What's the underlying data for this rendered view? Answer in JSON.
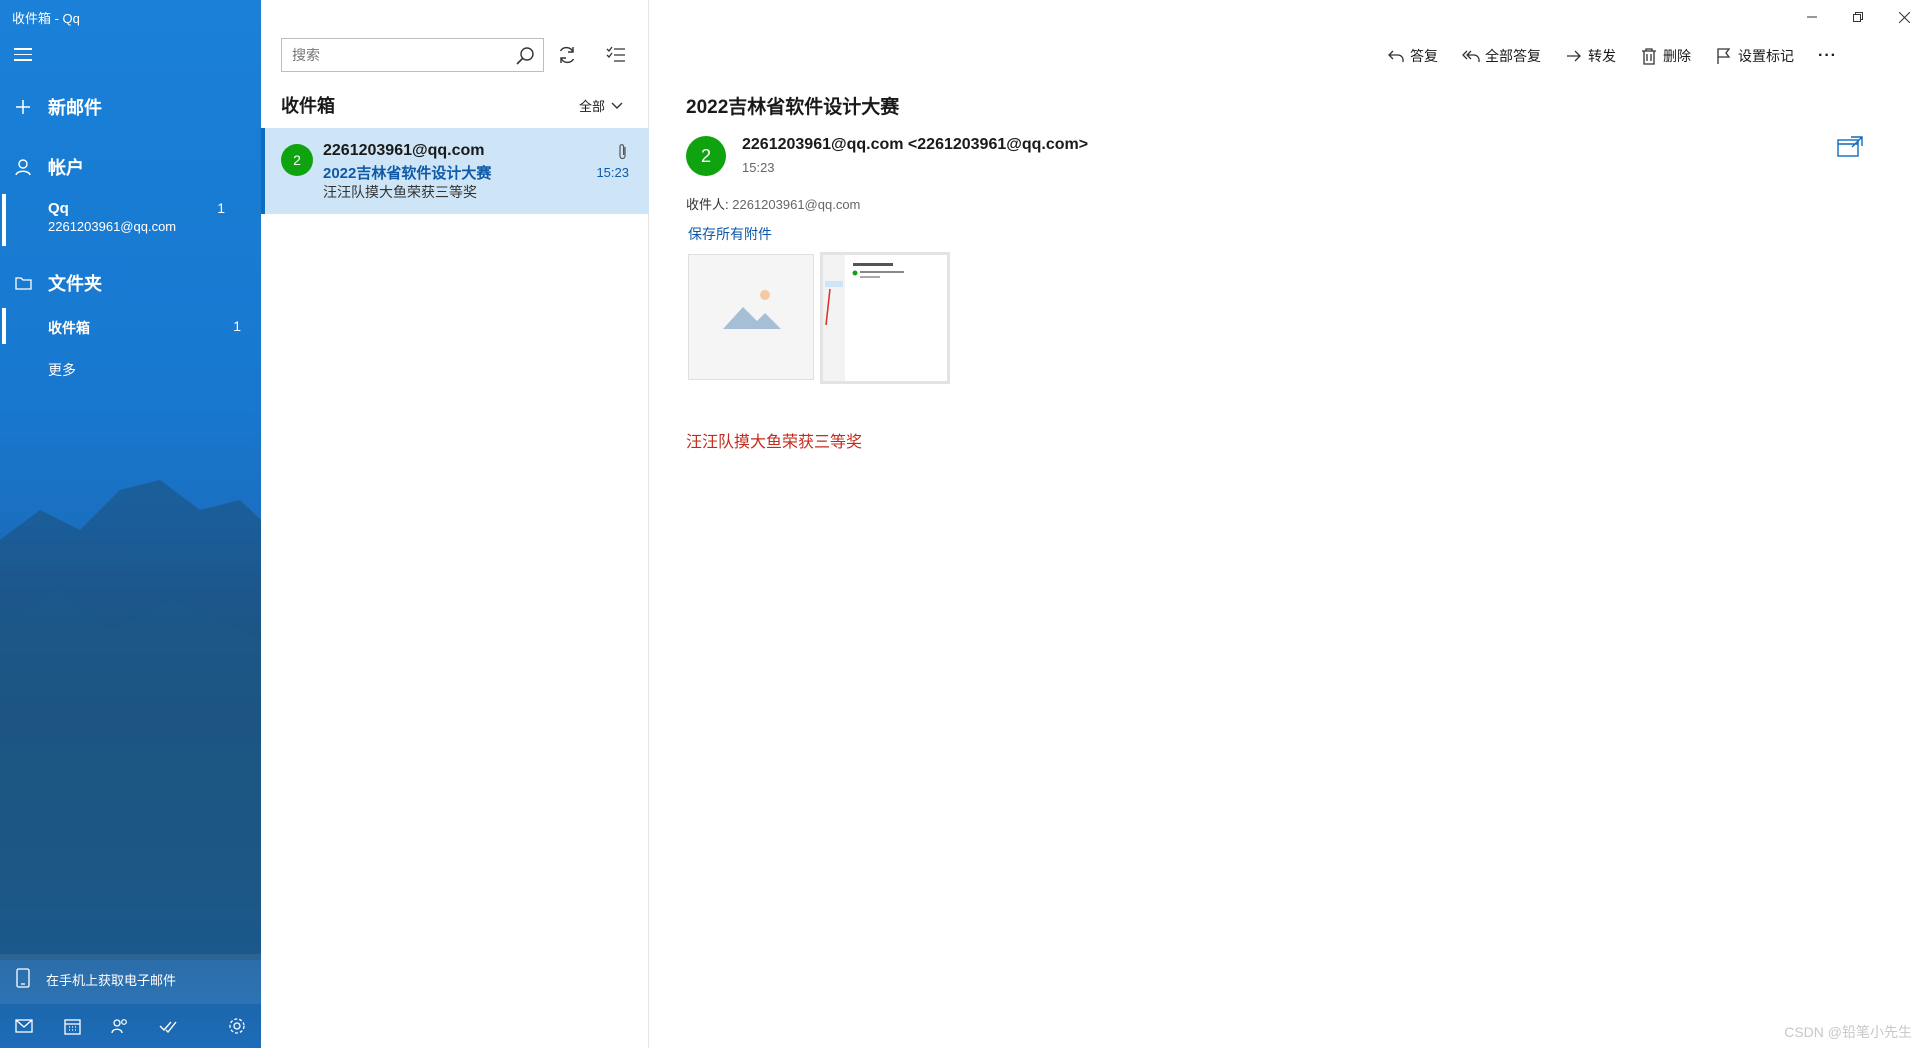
{
  "window": {
    "title": "收件箱 - Qq"
  },
  "nav": {
    "new_mail": "新邮件",
    "accounts_heading": "帐户",
    "account": {
      "name": "Qq",
      "address": "2261203961@qq.com",
      "unread": "1"
    },
    "folders_heading": "文件夹",
    "inbox": {
      "label": "收件箱",
      "unread": "1"
    },
    "more": "更多",
    "get_mobile": "在手机上获取电子邮件"
  },
  "list": {
    "search_placeholder": "搜索",
    "title": "收件箱",
    "filter": "全部",
    "messages": [
      {
        "avatar": "2",
        "from": "2261203961@qq.com",
        "subject": "2022吉林省软件设计大赛",
        "preview": "汪汪队摸大鱼荣获三等奖",
        "time": "15:23",
        "has_attachment": true
      }
    ]
  },
  "reading": {
    "commands": {
      "reply": "答复",
      "reply_all": "全部答复",
      "forward": "转发",
      "delete": "删除",
      "flag": "设置标记",
      "more": "···"
    },
    "subject": "2022吉林省软件设计大赛",
    "avatar": "2",
    "sender": "2261203961@qq.com <2261203961@qq.com>",
    "time": "15:23",
    "to_label": "收件人:",
    "to_value": "2261203961@qq.com",
    "save_all": "保存所有附件",
    "body": "汪汪队摸大鱼荣获三等奖"
  },
  "watermark": "CSDN @铅笔小先生",
  "colors": {
    "accent": "#0f6cbd",
    "avatar_green": "#10a310",
    "selection": "#cde5f7",
    "body_red": "#c42b1c"
  }
}
